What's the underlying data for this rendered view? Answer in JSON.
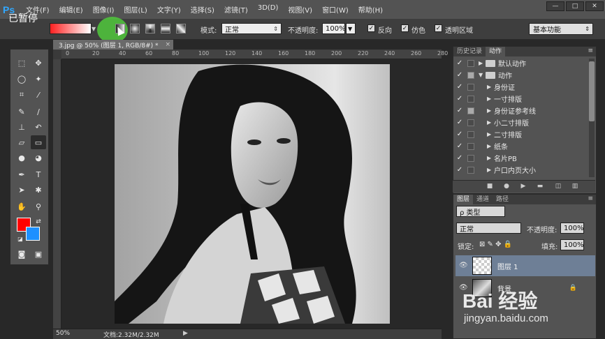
{
  "app": {
    "logo": "Ps"
  },
  "menu": [
    "文件(F)",
    "编辑(E)",
    "图像(I)",
    "图层(L)",
    "文字(Y)",
    "选择(S)",
    "滤镜(T)",
    "3D(D)",
    "视图(V)",
    "窗口(W)",
    "帮助(H)"
  ],
  "window_controls": {
    "minimize": "—",
    "maximize": "□",
    "close": "✕"
  },
  "overlay": {
    "paused_text": "已暂停"
  },
  "options": {
    "gradient_colors": [
      "#ff2020",
      "#ffffff"
    ],
    "mode_label": "模式:",
    "mode_value": "正常",
    "opacity_label": "不透明度:",
    "opacity_value": "100%",
    "reverse_label": "反向",
    "dither_label": "仿色",
    "transparency_label": "透明区域",
    "checkmark": "✓",
    "workspace": "基本功能"
  },
  "document": {
    "tab_title": "3.jpg @ 50% (图层 1, RGB/8#) *",
    "tab_close": "×",
    "ruler_ticks": [
      "0",
      "20",
      "40",
      "60",
      "80",
      "100",
      "120",
      "140",
      "160",
      "180",
      "200",
      "220",
      "240",
      "260",
      "280"
    ],
    "zoom": "50%",
    "doc_info": "文档:2.32M/2.32M",
    "status_arrow": "▶"
  },
  "colors": {
    "foreground": "#ff0000",
    "background": "#1e90ff"
  },
  "actions_panel": {
    "tabs": [
      "历史记录",
      "动作"
    ],
    "menu_icon": "≡",
    "rows": [
      {
        "checked": true,
        "dialog": false,
        "folder": true,
        "expanded": false,
        "label": "默认动作"
      },
      {
        "checked": true,
        "dialog": true,
        "folder": true,
        "expanded": true,
        "label": "动作"
      },
      {
        "checked": true,
        "dialog": false,
        "folder": false,
        "expanded": false,
        "label": "身份证"
      },
      {
        "checked": true,
        "dialog": false,
        "folder": false,
        "expanded": false,
        "label": "一寸排版"
      },
      {
        "checked": true,
        "dialog": true,
        "folder": false,
        "expanded": false,
        "label": "身份证参考线"
      },
      {
        "checked": true,
        "dialog": false,
        "folder": false,
        "expanded": false,
        "label": "小二寸排版"
      },
      {
        "checked": true,
        "dialog": false,
        "folder": false,
        "expanded": false,
        "label": "二寸排版"
      },
      {
        "checked": true,
        "dialog": false,
        "folder": false,
        "expanded": false,
        "label": "纸条"
      },
      {
        "checked": true,
        "dialog": false,
        "folder": false,
        "expanded": false,
        "label": "名片PB"
      },
      {
        "checked": true,
        "dialog": false,
        "folder": false,
        "expanded": false,
        "label": "户口内页大小"
      }
    ]
  },
  "layers_panel": {
    "tabs": [
      "图层",
      "通道",
      "路径"
    ],
    "menu_icon": "≡",
    "filter_label": "ρ 类型",
    "blend_mode": "正常",
    "opacity_label": "不透明度:",
    "opacity_value": "100%",
    "lock_label": "锁定:",
    "fill_label": "填充:",
    "fill_value": "100%",
    "layers": [
      {
        "name": "图层 1",
        "selected": true,
        "visible": true
      },
      {
        "name": "背景",
        "selected": false,
        "visible": true,
        "locked": true
      }
    ]
  },
  "watermark": {
    "logo": "Bai 经验",
    "url": "jingyan.baidu.com"
  }
}
